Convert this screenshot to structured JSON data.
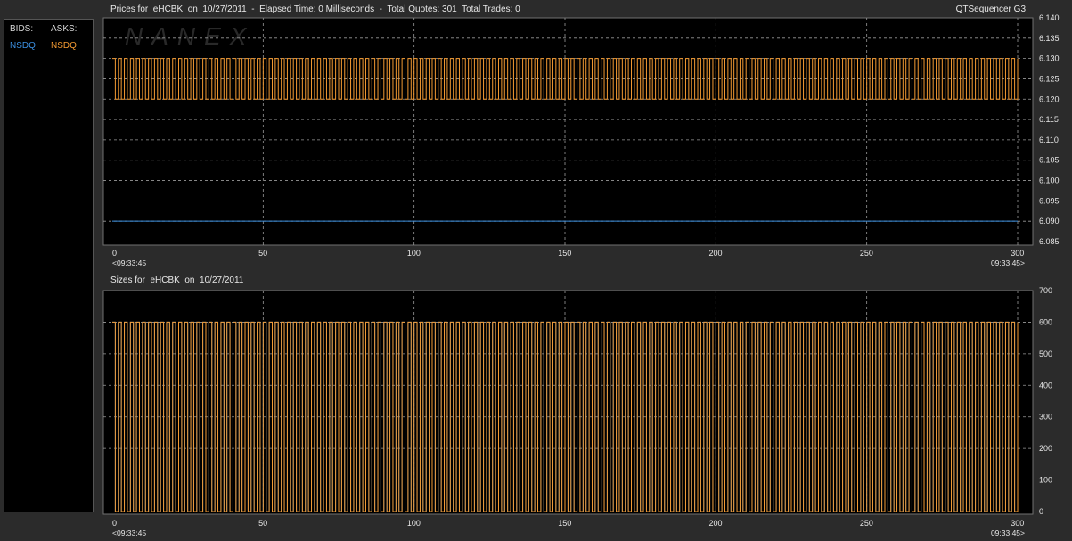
{
  "window": {
    "price_title": "Prices for  eHCBK  on  10/27/2011  -  Elapsed Time: 0 Milliseconds  -  Total Quotes: 301  Total Trades: 0",
    "app_name": "QTSequencer G3",
    "size_title": "Sizes for  eHCBK  on  10/27/2011",
    "watermark": "NANEX"
  },
  "legend": {
    "bids_label": "BIDS:",
    "asks_label": "ASKS:",
    "bid_exchange": "NSDQ",
    "ask_exchange": "NSDQ"
  },
  "colors": {
    "bid": "#3b8fe0",
    "ask": "#f39a32",
    "grid": "#9a9a9a",
    "plot_bg": "#000000",
    "window_bg": "#2b2b2b"
  },
  "chart_data": [
    {
      "type": "line",
      "title": "Prices for  eHCBK  on  10/27/2011  -  Elapsed Time: 0 Milliseconds  -  Total Quotes: 301  Total Trades: 0",
      "xlim": [
        0,
        300
      ],
      "x_ticks": [
        0,
        50,
        100,
        150,
        200,
        250,
        300
      ],
      "ylim": [
        6.085,
        6.14
      ],
      "y_ticks": [
        "6.085",
        "6.090",
        "6.095",
        "6.100",
        "6.105",
        "6.110",
        "6.115",
        "6.120",
        "6.125",
        "6.130",
        "6.135",
        "6.140"
      ],
      "start_time": "<09:33:45",
      "end_time": "09:33:45>",
      "grid": true,
      "series": [
        {
          "name": "NSDQ",
          "side": "bid",
          "pattern": "constant",
          "value": 6.09
        },
        {
          "name": "NSDQ",
          "side": "ask",
          "pattern": "alternating",
          "values": [
            6.13,
            6.12
          ],
          "points": 301
        }
      ]
    },
    {
      "type": "line",
      "title": "Sizes for  eHCBK  on  10/27/2011",
      "xlim": [
        0,
        300
      ],
      "x_ticks": [
        0,
        50,
        100,
        150,
        200,
        250,
        300
      ],
      "ylim": [
        0,
        700
      ],
      "y_ticks": [
        "0",
        "100",
        "200",
        "300",
        "400",
        "500",
        "600",
        "700"
      ],
      "start_time": "<09:33:45",
      "end_time": "09:33:45>",
      "grid": true,
      "series": [
        {
          "name": "NSDQ",
          "side": "bid",
          "pattern": "alternating",
          "values": [
            600,
            0
          ],
          "points": 301
        },
        {
          "name": "NSDQ",
          "side": "ask",
          "pattern": "alternating",
          "values": [
            600,
            0
          ],
          "points": 301
        }
      ]
    }
  ]
}
